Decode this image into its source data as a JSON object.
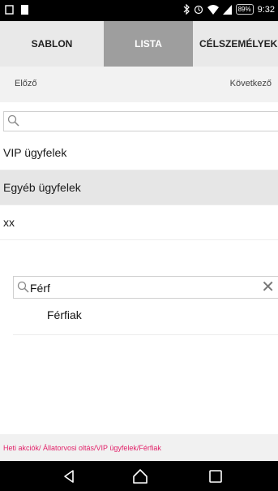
{
  "status_bar": {
    "time": "9:32",
    "battery": "89%",
    "icons": [
      "notification-icon",
      "sim-icon",
      "bluetooth-icon",
      "alarm-icon",
      "wifi-icon",
      "signal-icon",
      "battery-icon"
    ]
  },
  "tabs": [
    {
      "label": "SABLON",
      "active": false
    },
    {
      "label": "LISTA",
      "active": true
    },
    {
      "label": "CÉLSZEMÉLYEK",
      "active": false
    }
  ],
  "nav": {
    "prev": "Előző",
    "next": "Következő"
  },
  "search_top": {
    "value": "",
    "placeholder": ""
  },
  "list": [
    {
      "label": "VIP ügyfelek",
      "selected": false
    },
    {
      "label": "Egyéb ügyfelek",
      "selected": true
    },
    {
      "label": "xx",
      "selected": false
    }
  ],
  "search_bottom": {
    "value": "Férf",
    "clear_icon": "close-icon"
  },
  "results": [
    {
      "label": "Férfiak"
    }
  ],
  "breadcrumb": "Heti akciók/ Állatorvosi oltás/VIP ügyfelek/Férfiak",
  "colors": {
    "accent": "#e2236a",
    "active_tab": "#9e9e9e",
    "tab_bar": "#e9e9e9",
    "selected_row": "#e6e6e6"
  },
  "system_nav": [
    "back-icon",
    "home-icon",
    "recent-apps-icon"
  ]
}
